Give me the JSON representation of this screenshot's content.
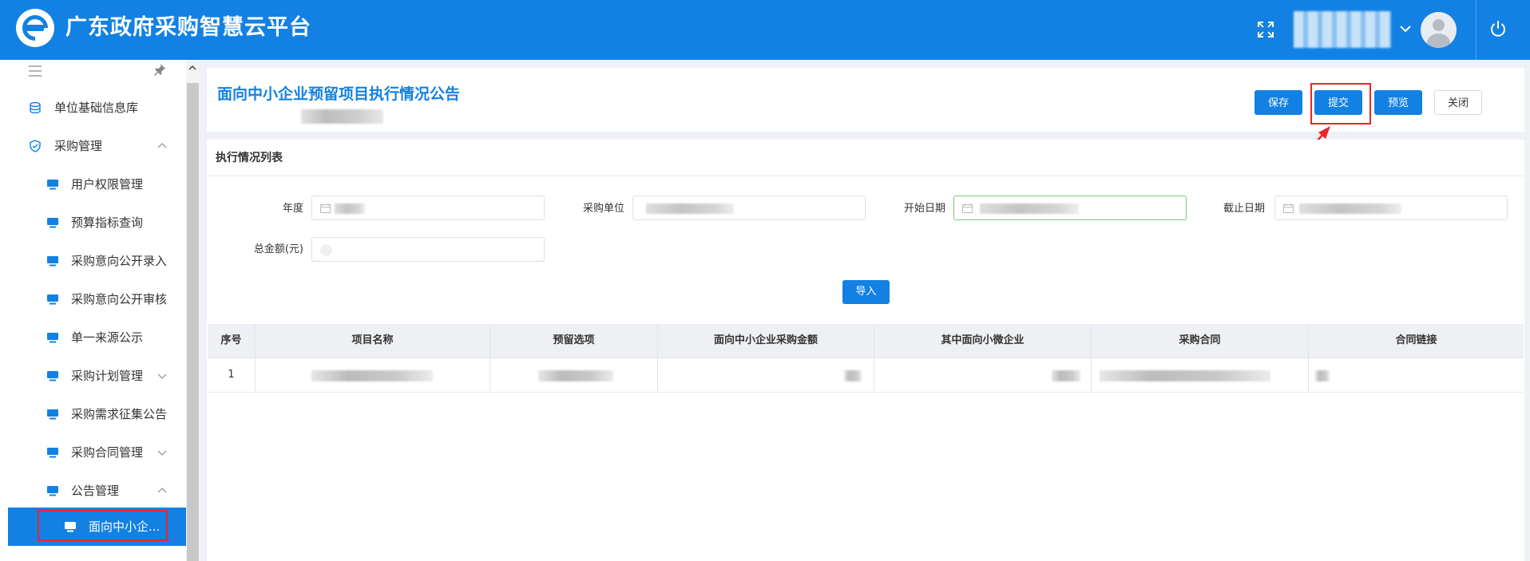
{
  "app": {
    "title": "广东政府采购智慧云平台"
  },
  "sidebar": {
    "items": [
      {
        "label": "单位基础信息库",
        "icon": "database-icon"
      },
      {
        "label": "采购管理",
        "icon": "shield-icon",
        "expanded": true
      },
      {
        "label": "用户权限管理",
        "icon": "monitor-icon"
      },
      {
        "label": "预算指标查询",
        "icon": "monitor-icon"
      },
      {
        "label": "采购意向公开录入",
        "icon": "monitor-icon"
      },
      {
        "label": "采购意向公开审核",
        "icon": "monitor-icon"
      },
      {
        "label": "单一来源公示",
        "icon": "monitor-icon"
      },
      {
        "label": "采购计划管理",
        "icon": "monitor-icon",
        "expanded": false
      },
      {
        "label": "采购需求征集公告",
        "icon": "monitor-icon"
      },
      {
        "label": "采购合同管理",
        "icon": "monitor-icon",
        "expanded": false
      },
      {
        "label": "公告管理",
        "icon": "monitor-icon",
        "expanded": true
      },
      {
        "label": "面向中小企...",
        "icon": "monitor-icon",
        "active": true
      }
    ]
  },
  "page": {
    "title": "面向中小企业预留项目执行情况公告",
    "buttons": {
      "save": "保存",
      "submit": "提交",
      "preview": "预览",
      "close": "关闭"
    }
  },
  "list": {
    "title": "执行情况列表",
    "form": {
      "year_label": "年度",
      "unit_label": "采购单位",
      "start_label": "开始日期",
      "end_label": "截止日期",
      "amount_label": "总金额(元)"
    },
    "import_label": "导入",
    "table": {
      "headers": [
        "序号",
        "项目名称",
        "预留选项",
        "面向中小企业采购金额",
        "其中面向小微企业",
        "采购合同",
        "合同链接"
      ],
      "rows": [
        {
          "index": "1"
        }
      ]
    }
  },
  "colors": {
    "brand": "#1281e3",
    "highlight": "#e6262a"
  }
}
